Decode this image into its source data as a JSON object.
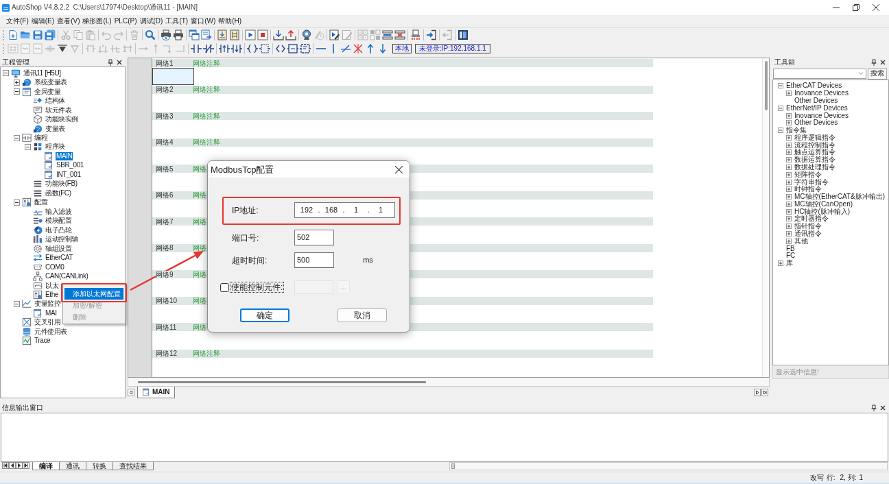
{
  "window": {
    "title": "AutoShop V4.8.2.2  C:\\Users\\17974\\Desktop\\通讯11 - [MAIN]"
  },
  "menu": [
    "文件(F)",
    "编辑(E)",
    "查看(V)",
    "梯形图(L)",
    "PLC(P)",
    "调试(D)",
    "工具(T)",
    "窗口(W)",
    "帮助(H)"
  ],
  "toolbar_1": {
    "groups": [
      [
        {
          "disabled": false
        },
        {
          "disabled": false
        },
        {
          "disabled": false
        },
        {
          "disabled": false
        }
      ],
      [
        {
          "disabled": true
        },
        {
          "disabled": true
        },
        {
          "disabled": true
        }
      ],
      [
        {
          "disabled": true
        },
        {
          "disabled": true
        }
      ],
      [
        {
          "disabled": true
        }
      ],
      [
        {
          "disabled": false
        }
      ],
      [
        {
          "disabled": false
        },
        {
          "disabled": false
        }
      ],
      [
        {
          "disabled": false
        },
        {
          "disabled": false
        }
      ],
      [
        {
          "disabled": false
        },
        {
          "disabled": false
        }
      ],
      [
        {
          "disabled": false
        },
        {
          "disabled": false
        }
      ],
      [
        {
          "disabled": false
        },
        {
          "disabled": false
        }
      ],
      [
        {
          "disabled": false
        },
        {
          "disabled": true
        }
      ],
      [
        {
          "disabled": false
        },
        {
          "disabled": true
        }
      ],
      [
        {
          "disabled": true
        },
        {
          "disabled": true
        },
        {
          "disabled": false
        },
        {
          "disabled": false
        }
      ],
      [
        {
          "disabled": false
        }
      ],
      [
        {
          "disabled": false
        }
      ],
      [
        {
          "disabled": true
        }
      ],
      [
        {
          "disabled": false
        }
      ]
    ]
  },
  "toolbar_2": {
    "groups": [
      [
        {
          "disabled": true
        },
        {
          "disabled": true
        },
        {
          "disabled": true
        },
        {
          "disabled": true
        },
        {
          "disabled": false
        },
        {
          "disabled": true
        }
      ],
      [
        {
          "disabled": true
        },
        {
          "disabled": true
        },
        {
          "disabled": true
        },
        {
          "disabled": true
        }
      ],
      [
        {
          "disabled": true
        },
        {
          "disabled": true
        },
        {
          "disabled": true
        },
        {
          "disabled": true
        }
      ],
      [
        {
          "disabled": false
        },
        {
          "disabled": false
        }
      ],
      [
        {
          "disabled": false
        },
        {
          "disabled": false
        }
      ],
      [
        {
          "disabled": false
        },
        {
          "disabled": false
        }
      ],
      [
        {
          "disabled": false
        },
        {
          "disabled": false
        },
        {
          "disabled": false
        }
      ],
      [
        {
          "disabled": false
        },
        {
          "disabled": false
        },
        {
          "disabled": false
        },
        {
          "disabled": false
        },
        {
          "disabled": false
        },
        {
          "disabled": false
        }
      ]
    ],
    "mode": "本地",
    "login_status": "未登录:IP:192.168.1.1"
  },
  "project_panel": {
    "title": "工程管理",
    "tree": [
      {
        "label": "通讯11 [H5U]",
        "expanded": true,
        "selected": false,
        "children": [
          {
            "label": "系统变量表",
            "expanded": false,
            "selected": false
          },
          {
            "label": "全局变量",
            "expanded": true,
            "selected": false,
            "children": [
              {
                "label": "结构体",
                "selected": false
              },
              {
                "label": "软元件表",
                "selected": false
              },
              {
                "label": "功能块实例",
                "selected": false
              },
              {
                "label": "变量表",
                "selected": false
              }
            ]
          },
          {
            "label": "编程",
            "expanded": true,
            "selected": false,
            "children": [
              {
                "label": "程序块",
                "expanded": true,
                "selected": false,
                "children": [
                  {
                    "label": "MAIN",
                    "selected": true
                  },
                  {
                    "label": "SBR_001",
                    "selected": false
                  },
                  {
                    "label": "INT_001",
                    "selected": false
                  }
                ]
              },
              {
                "label": "功能块(FB)",
                "selected": false
              },
              {
                "label": "函数(FC)",
                "selected": false
              }
            ]
          },
          {
            "label": "配置",
            "expanded": true,
            "selected": false,
            "children": [
              {
                "label": "输入滤波",
                "selected": false
              },
              {
                "label": "模块配置",
                "selected": false
              },
              {
                "label": "电子凸轮",
                "selected": false
              },
              {
                "label": "运动控制轴",
                "selected": false
              },
              {
                "label": "轴组设置",
                "selected": false
              },
              {
                "label": "EtherCAT",
                "selected": false
              },
              {
                "label": "COM0",
                "selected": false
              },
              {
                "label": "CAN(CANLink)",
                "selected": false
              },
              {
                "label": "以太",
                "selected": false
              },
              {
                "label": "Ethe",
                "selected": false
              }
            ]
          },
          {
            "label": "变量监控",
            "expanded": true,
            "selected": false,
            "children": [
              {
                "label": "MAI",
                "selected": false
              }
            ]
          },
          {
            "label": "交叉引用",
            "selected": false
          },
          {
            "label": "元件使用表",
            "selected": false
          },
          {
            "label": "Trace",
            "selected": false
          }
        ]
      }
    ]
  },
  "editor": {
    "networks": [
      {
        "label": "网络1",
        "comment": "网络注释",
        "selected": true
      },
      {
        "label": "网络2",
        "comment": "网络注释",
        "selected": false
      },
      {
        "label": "网络3",
        "comment": "网络注释",
        "selected": false
      },
      {
        "label": "网络4",
        "comment": "网络注释",
        "selected": false
      },
      {
        "label": "网络5",
        "comment": "网络",
        "selected": false
      },
      {
        "label": "网络6",
        "comment": "网络",
        "selected": false
      },
      {
        "label": "网络7",
        "comment": "网络",
        "selected": false
      },
      {
        "label": "网络8",
        "comment": "网络",
        "selected": false
      },
      {
        "label": "网络9",
        "comment": "网络",
        "selected": false
      },
      {
        "label": "网络10",
        "comment": "网络",
        "selected": false
      },
      {
        "label": "网络11",
        "comment": "网络",
        "selected": false
      },
      {
        "label": "网络12",
        "comment": "网络注释",
        "selected": false
      }
    ],
    "tabs": [
      {
        "label": "MAIN",
        "selected": true
      }
    ]
  },
  "context_menu": {
    "items": [
      {
        "label": "添加以太网配置",
        "selected": true,
        "disabled": false,
        "marked": true
      },
      {
        "label": "加密/解密",
        "selected": false,
        "disabled": true,
        "marked": false
      },
      {
        "label": "删除",
        "selected": false,
        "disabled": true,
        "marked": false
      }
    ]
  },
  "callout_arrow": true,
  "dialog": {
    "title": "ModbusTcp配置",
    "fields": [
      {
        "kind": "ip",
        "label": "IP地址:",
        "octets": [
          "192",
          "168",
          "1",
          "1"
        ],
        "separators": [
          ".",
          ".",
          "."
        ],
        "marked": true
      },
      {
        "kind": "text",
        "label": "端口号:",
        "value": "502",
        "marked": false
      },
      {
        "kind": "text",
        "label": "超时时间:",
        "value": "500",
        "unit": "ms",
        "marked": false
      }
    ],
    "enable_option": {
      "label": "使能控制元件:",
      "checked": false,
      "focused": true,
      "field_disabled": true,
      "browse_label": "..."
    },
    "buttons": [
      {
        "label": "确定",
        "default": true
      },
      {
        "label": "取消",
        "default": false
      }
    ]
  },
  "toolbox": {
    "title": "工具箱",
    "search_button": "搜索",
    "tree": [
      {
        "label": "EtherCAT Devices",
        "expanded": true,
        "children": [
          {
            "label": "Inovance Devices",
            "expanded": false
          },
          {
            "label": "Other Devices"
          }
        ]
      },
      {
        "label": "EtherNet/IP Devices",
        "expanded": true,
        "children": [
          {
            "label": "Inovance Devices",
            "expanded": false
          },
          {
            "label": "Other Devices",
            "expanded": false
          }
        ]
      },
      {
        "label": "指令集",
        "expanded": true,
        "children": [
          {
            "label": "程序逻辑指令",
            "expanded": false
          },
          {
            "label": "流程控制指令",
            "expanded": false
          },
          {
            "label": "触点运算指令",
            "expanded": false
          },
          {
            "label": "数据运算指令",
            "expanded": false
          },
          {
            "label": "数据处理指令",
            "expanded": false
          },
          {
            "label": "矩阵指令",
            "expanded": false
          },
          {
            "label": "字符串指令",
            "expanded": false
          },
          {
            "label": "时钟指令",
            "expanded": false
          },
          {
            "label": "MC轴控(EtherCAT&脉冲输出)",
            "expanded": false
          },
          {
            "label": "MC轴控(CanOpen)",
            "expanded": false
          },
          {
            "label": "HC轴控(脉冲输入)",
            "expanded": false
          },
          {
            "label": "定时器指令",
            "expanded": false
          },
          {
            "label": "指针指令",
            "expanded": false
          },
          {
            "label": "通讯指令",
            "expanded": false
          },
          {
            "label": "其他",
            "expanded": false
          }
        ]
      },
      {
        "label": "FB"
      },
      {
        "label": "FC"
      },
      {
        "label": "库",
        "expanded": false
      }
    ],
    "info": "显示选中信息!"
  },
  "output": {
    "title": "信息输出窗口",
    "tabs": [
      {
        "label": "编译",
        "selected": true
      },
      {
        "label": "通讯",
        "selected": false
      },
      {
        "label": "转换",
        "selected": false
      },
      {
        "label": "查找结果",
        "selected": false
      }
    ]
  },
  "status_bar": [
    "改写",
    "行:",
    "2, 列:",
    "1"
  ]
}
